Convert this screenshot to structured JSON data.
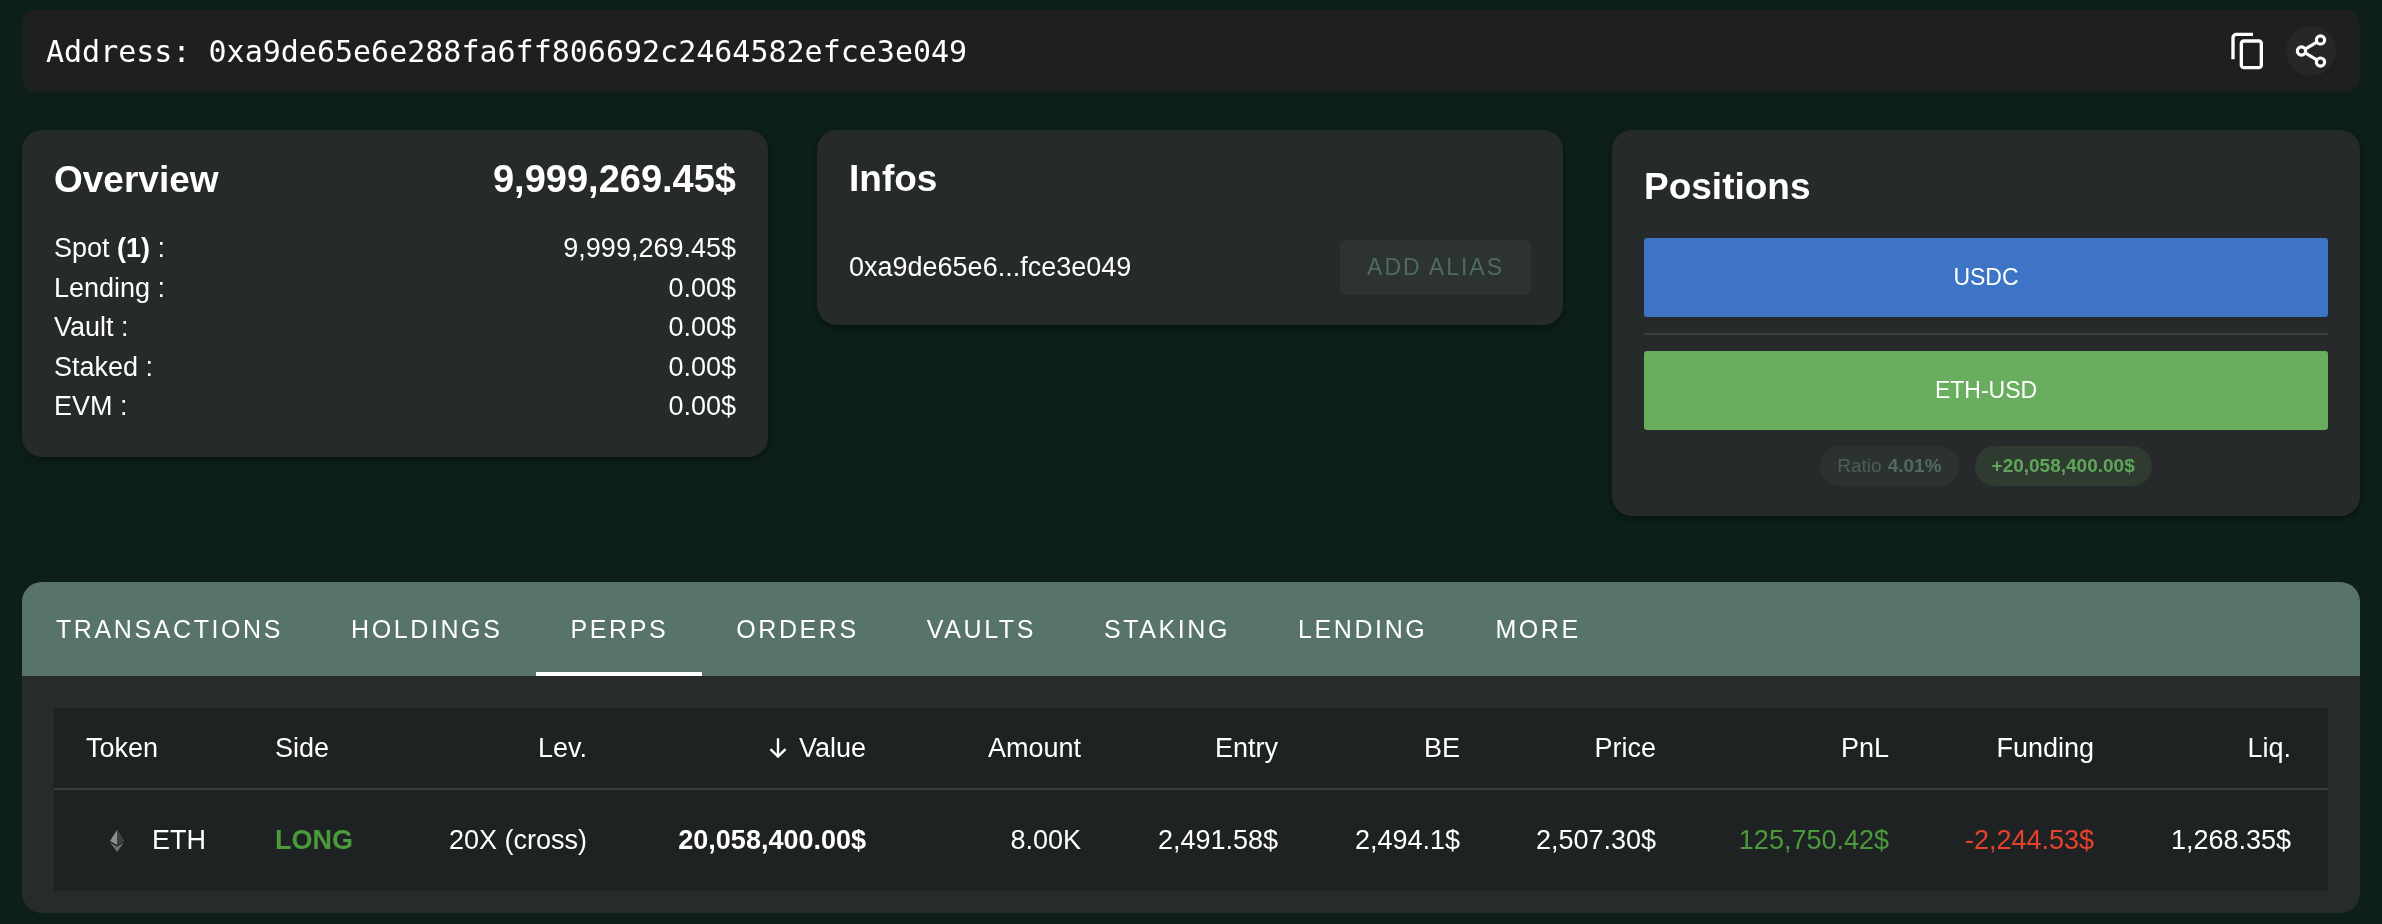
{
  "address_bar": {
    "label": "Address:",
    "address": "0xa9de65e6e288fa6ff806692c2464582efce3e049"
  },
  "overview": {
    "title": "Overview",
    "total": "9,999,269.45$",
    "rows": [
      {
        "label": "Spot **(1)** :",
        "value": "9,999,269.45$"
      },
      {
        "label": "Lending :",
        "value": "0.00$"
      },
      {
        "label": "Vault :",
        "value": "0.00$"
      },
      {
        "label": "Staked :",
        "value": "0.00$"
      },
      {
        "label": "EVM :",
        "value": "0.00$"
      }
    ]
  },
  "infos": {
    "title": "Infos",
    "short_address": "0xa9de65e6...fce3e049",
    "button": "ADD ALIAS",
    "button_disabled": true
  },
  "positions": {
    "title": "Positions",
    "bars": [
      {
        "label": "USDC",
        "color": "#3d74c6"
      },
      {
        "label": "ETH-USD",
        "color": "#69ad5e"
      }
    ],
    "ratio_label": "Ratio",
    "ratio_value": "4.01%",
    "total_change": "+20,058,400.00$"
  },
  "tabs": [
    {
      "label": "TRANSACTIONS",
      "selected": false
    },
    {
      "label": "HOLDINGS",
      "selected": false
    },
    {
      "label": "PERPS",
      "selected": true
    },
    {
      "label": "ORDERS",
      "selected": false
    },
    {
      "label": "VAULTS",
      "selected": false
    },
    {
      "label": "STAKING",
      "selected": false
    },
    {
      "label": "LENDING",
      "selected": false
    },
    {
      "label": "MORE",
      "selected": false
    }
  ],
  "table": {
    "columns": [
      {
        "label": "Token",
        "kind": "text",
        "sorted": false
      },
      {
        "label": "Side",
        "kind": "text",
        "sorted": false
      },
      {
        "label": "Lev.",
        "kind": "number",
        "sorted": false
      },
      {
        "label": "Value",
        "kind": "number",
        "sorted": true
      },
      {
        "label": "Amount",
        "kind": "number",
        "sorted": false
      },
      {
        "label": "Entry",
        "kind": "number",
        "sorted": false
      },
      {
        "label": "BE",
        "kind": "number",
        "sorted": false
      },
      {
        "label": "Price",
        "kind": "number",
        "sorted": false
      },
      {
        "label": "PnL",
        "kind": "number",
        "sorted": false
      },
      {
        "label": "Funding",
        "kind": "number",
        "sorted": false
      },
      {
        "label": "Liq.",
        "kind": "number",
        "sorted": false
      }
    ],
    "rows": [
      [
        {
          "text": "ETH",
          "kind": "token"
        },
        {
          "text": "LONG",
          "kind": "side"
        },
        {
          "text": "20X (cross)",
          "kind": "plain"
        },
        {
          "text": "20,058,400.00$",
          "kind": "total"
        },
        {
          "text": "8.00K",
          "kind": "plain"
        },
        {
          "text": "2,491.58$",
          "kind": "plain"
        },
        {
          "text": "2,494.1$",
          "kind": "plain"
        },
        {
          "text": "2,507.30$",
          "kind": "plain"
        },
        {
          "text": "125,750.42$",
          "kind": "gain"
        },
        {
          "text": "-2,244.53$",
          "kind": "loss"
        },
        {
          "text": "1,268.35$",
          "kind": "plain"
        }
      ]
    ]
  }
}
